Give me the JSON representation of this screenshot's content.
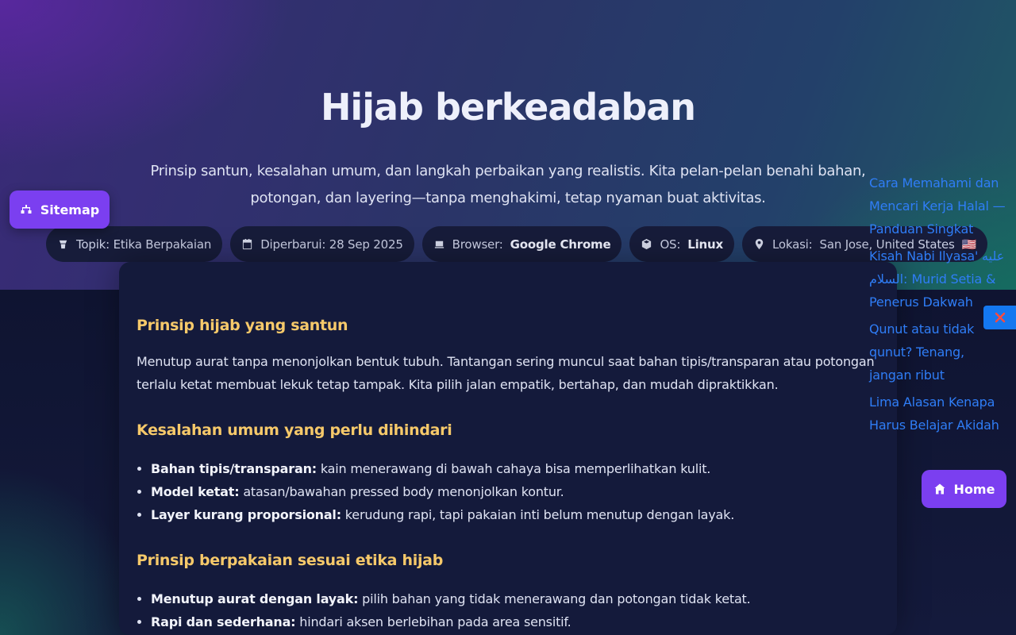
{
  "hero": {
    "title": "Hijab berkeadaban",
    "subtitle": "Prinsip santun, kesalahan umum, dan langkah perbaikan yang realistis. Kita pelan-pelan benahi bahan, potongan, dan layering—tanpa menghakimi, tetap nyaman buat aktivitas."
  },
  "chips": {
    "topic": "Topik: Etika Berpakaian",
    "updated": "Diperbarui: 28 Sep 2025",
    "browser_label": "Browser:",
    "browser_value": "Google Chrome",
    "os_label": "OS:",
    "os_value": "Linux",
    "location_label": "Lokasi:",
    "location_value": "San Jose, United States",
    "flag": "🇺🇸"
  },
  "buttons": {
    "sitemap": "Sitemap",
    "home": "Home"
  },
  "article": {
    "section1_title": "Prinsip hijab yang santun",
    "section1_text": "Menutup aurat tanpa menonjolkan bentuk tubuh. Tantangan sering muncul saat bahan tipis/transparan atau potongan terlalu ketat membuat lekuk tetap tampak. Kita pilih jalan empatik, bertahap, dan mudah dipraktikkan.",
    "section2_title": "Kesalahan umum yang perlu dihindari",
    "section2_items": [
      {
        "label": "Bahan tipis/transparan:",
        "text": " kain menerawang di bawah cahaya bisa memperlihatkan kulit."
      },
      {
        "label": "Model ketat:",
        "text": " atasan/bawahan pressed body menonjolkan kontur."
      },
      {
        "label": "Layer kurang proporsional:",
        "text": " kerudung rapi, tapi pakaian inti belum menutup dengan layak."
      }
    ],
    "section3_title": "Prinsip berpakaian sesuai etika hijab",
    "section3_items": [
      {
        "label": "Menutup aurat dengan layak:",
        "text": " pilih bahan yang tidak menerawang dan potongan tidak ketat."
      },
      {
        "label": "Rapi dan sederhana:",
        "text": " hindari aksen berlebihan pada area sensitif."
      }
    ]
  },
  "side_links": [
    "Cara Memahami dan Mencari Kerja Halal — Panduan Singkat",
    "Kisah Nabi Ilyasa' عليه السلام: Murid Setia & Penerus Dakwah",
    "Qunut atau tidak qunut? Tenang, jangan ribut",
    "Lima Alasan Kenapa Harus Belajar Akidah"
  ],
  "colors": {
    "accent_purple": "#7b3ff0",
    "heading_yellow": "#f6c96a",
    "link_blue": "#2f7df6",
    "close_blue": "#1478f0",
    "close_x_red": "#ff4a3d"
  },
  "icons": {
    "sitemap": "sitemap-icon",
    "topic": "hanger-icon",
    "updated": "calendar-icon",
    "browser": "monitor-icon",
    "os": "cube-icon",
    "location": "map-pin-icon",
    "close": "close-icon",
    "home": "home-icon"
  }
}
